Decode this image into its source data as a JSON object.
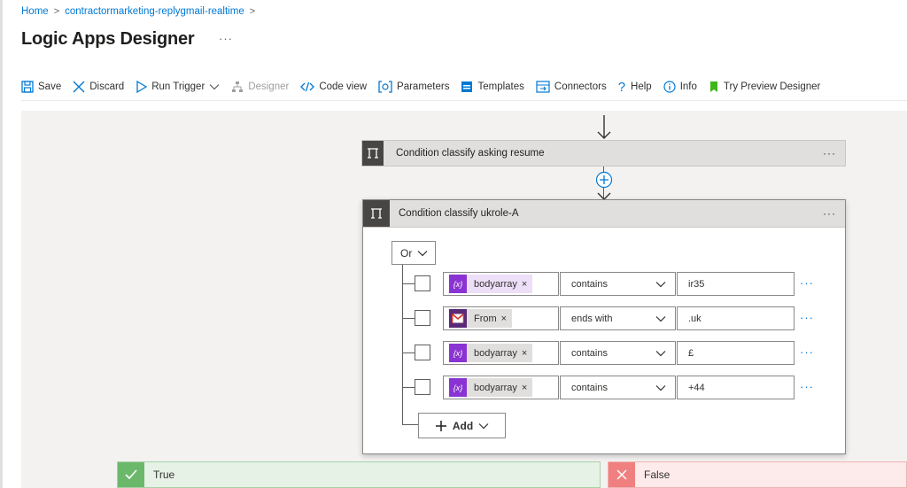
{
  "breadcrumb": {
    "home": "Home",
    "resource": "contractormarketing-replygmail-realtime",
    "separator": ">"
  },
  "page": {
    "title": "Logic Apps Designer",
    "more": "···"
  },
  "toolbar": {
    "save": "Save",
    "discard": "Discard",
    "run_trigger": "Run Trigger",
    "designer": "Designer",
    "code_view": "Code view",
    "parameters": "Parameters",
    "templates": "Templates",
    "connectors": "Connectors",
    "help": "Help",
    "info": "Info",
    "try_preview": "Try Preview Designer"
  },
  "actions": {
    "condition1_title": "Condition classify asking resume",
    "condition2_title": "Condition classify ukrole-A",
    "more": "···"
  },
  "condition": {
    "operator": "Or",
    "rows": [
      {
        "token": "bodyarray",
        "token_type": "variable",
        "op": "contains",
        "value": "ir35"
      },
      {
        "token": "From",
        "token_type": "gmail",
        "op": "ends with",
        "value": ".uk"
      },
      {
        "token": "bodyarray",
        "token_type": "variable",
        "op": "contains",
        "value": "£"
      },
      {
        "token": "bodyarray",
        "token_type": "variable",
        "op": "contains",
        "value": "+44"
      }
    ],
    "row_more": "···",
    "token_remove": "×",
    "add_label": "Add",
    "variable_icon": "{x}"
  },
  "branches": {
    "true_label": "True",
    "false_label": "False"
  },
  "colors": {
    "accent": "#0078d4",
    "variable_token": "#8a33d3",
    "true": "#6bb86b",
    "false": "#f08080"
  }
}
